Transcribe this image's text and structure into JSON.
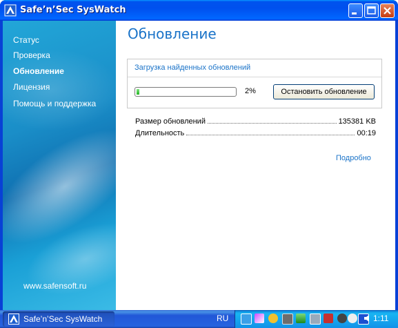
{
  "window": {
    "title": "Safe’n’Sec SysWatch"
  },
  "sidebar": {
    "items": [
      {
        "label": "Статус"
      },
      {
        "label": "Проверка"
      },
      {
        "label": "Обновление",
        "active": true
      },
      {
        "label": "Лицензия"
      },
      {
        "label": "Помощь и поддержка"
      }
    ],
    "site": "www.safensoft.ru"
  },
  "main": {
    "title": "Обновление",
    "download_group_title": "Загрузка найденных обновлений",
    "progress": {
      "percent": 2,
      "label": "2%"
    },
    "stop_button": "Остановить обновление",
    "stats": [
      {
        "label": "Размер обновлений",
        "value": "135381 KB"
      },
      {
        "label": "Длительность",
        "value": "00:19"
      }
    ],
    "details_link": "Подробно"
  },
  "taskbar": {
    "task_label": "Safe’n’Sec SysWatch",
    "language": "RU",
    "clock": "1:11",
    "tray_icons": [
      "network-icon",
      "pen-icon",
      "check-icon",
      "monitor-icon",
      "wireless-icon",
      "shield-icon",
      "printer-icon",
      "disk-icon",
      "smiley-icon",
      "security-shield-icon",
      "speaker-icon"
    ]
  },
  "colors": {
    "accent": "#1a73c8",
    "titlebar": "#0053ee",
    "progress": "#24b224"
  }
}
